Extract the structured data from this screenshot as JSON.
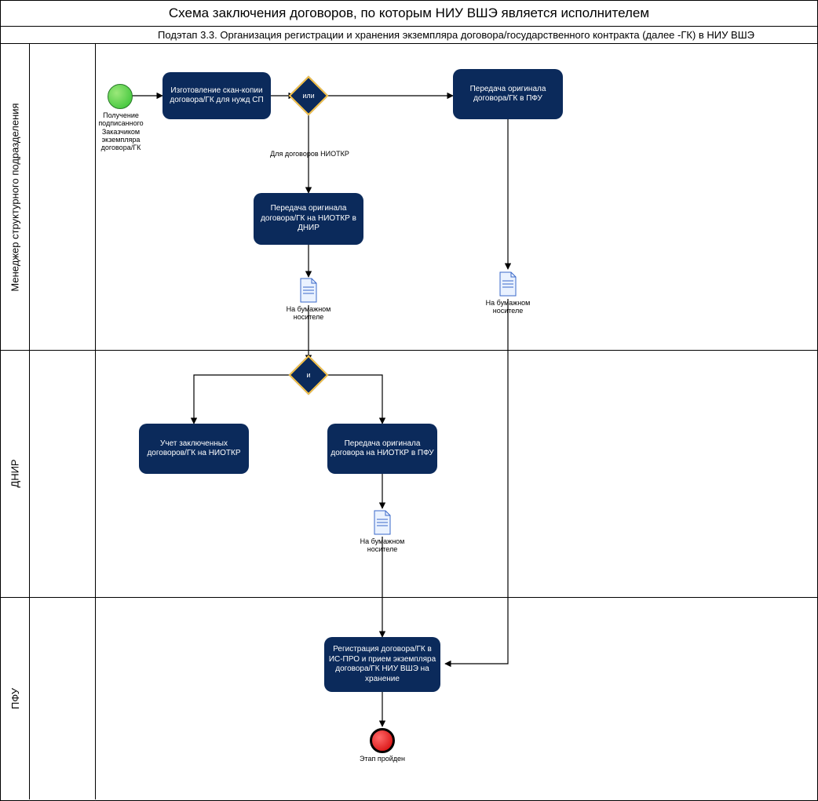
{
  "title": "Схема заключения договоров, по которым НИУ ВШЭ является исполнителем",
  "subtitle": "Подэтап 3.3. Организация регистрации и хранения экземпляра  договора/государственного контракта (далее -ГК) в НИУ ВШЭ",
  "lanes": {
    "lane1": "Менеджер структурного подразделения",
    "lane2": "ДНИР",
    "lane3": "ПФУ"
  },
  "events": {
    "start_label": "Получение подписанного Заказчиком экземпляра договора/ГК",
    "end_label": "Этап пройден"
  },
  "gateways": {
    "g_or": "или",
    "g_and": "и"
  },
  "tasks": {
    "t_scan": "Изготовление скан-копии договора/ГК для нужд СП",
    "t_to_pfu": "Передача оригинала договора/ГК в ПФУ",
    "t_to_dnir": "Передача оригинала договора/ГК на НИОТКР в ДНИР",
    "t_account": "Учет заключенных договоров/ГК на НИОТКР",
    "t_to_pfu2": "Передача оригинала договора на НИОТКР в ПФУ",
    "t_register": "Регистрация договора/ГК в ИС-ПРО и прием экземпляра договора/ГК НИУ ВШЭ на хранение"
  },
  "annotations": {
    "for_niotkr": "Для договоров НИОТКР",
    "paper_medium": "На бумажном носителе"
  }
}
